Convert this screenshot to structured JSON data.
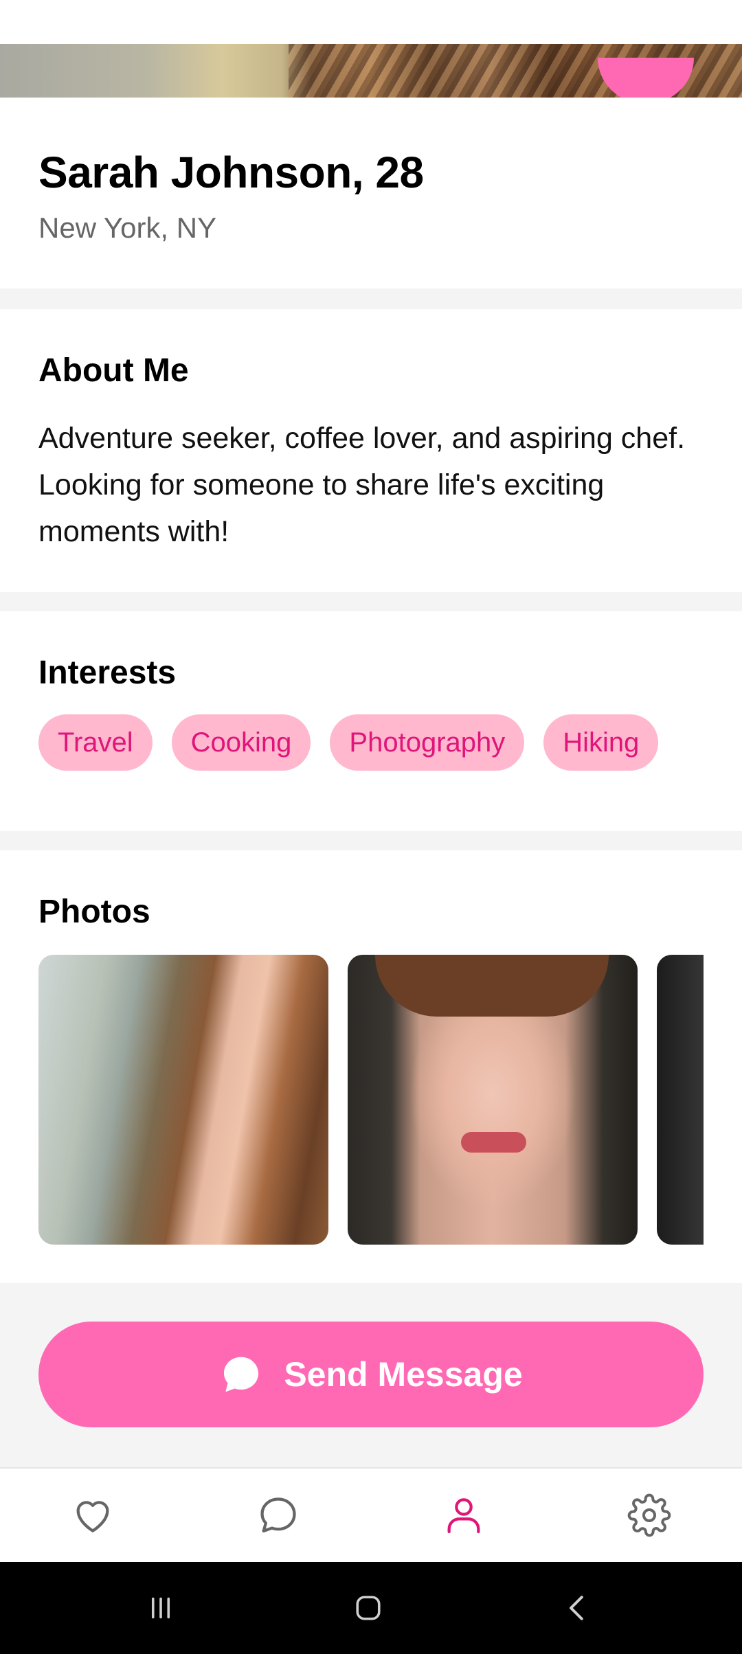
{
  "profile": {
    "name_age": "Sarah Johnson, 28",
    "location": "New York, NY"
  },
  "about": {
    "title": "About Me",
    "text": "Adventure seeker, coffee lover, and aspiring chef. Looking for someone to share life's exciting moments with!"
  },
  "interests": {
    "title": "Interests",
    "items": [
      "Travel",
      "Cooking",
      "Photography",
      "Hiking"
    ]
  },
  "photos": {
    "title": "Photos"
  },
  "actions": {
    "send_label": "Send Message",
    "send_icon": "chat-bubble-icon"
  },
  "bottom_nav": {
    "items": [
      {
        "icon": "heart-icon",
        "active": false
      },
      {
        "icon": "chat-icon",
        "active": false
      },
      {
        "icon": "profile-icon",
        "active": true
      },
      {
        "icon": "gear-icon",
        "active": false
      }
    ]
  },
  "colors": {
    "accent": "#ff69b4",
    "chip_bg": "#ffb8ce",
    "chip_text": "#e0157a",
    "active_nav": "#e0157a",
    "inactive_nav": "#666666"
  }
}
